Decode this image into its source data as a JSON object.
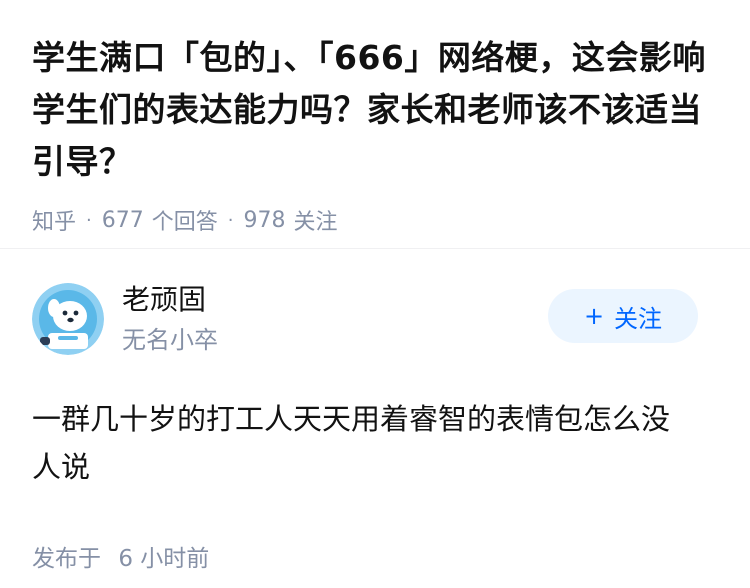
{
  "question": {
    "title": "学生满口「包的」、「666」网络梗，这会影响学生们的表达能力吗？家长和老师该不该适当引导？",
    "source": "知乎",
    "answer_count": "677",
    "answer_label": "个回答",
    "follower_count": "978",
    "follower_label": "关注"
  },
  "answer": {
    "author_name": "老顽固",
    "author_headline": "无名小卒",
    "follow_label": "关注",
    "follow_icon": "plus-icon",
    "content": "一群几十岁的打工人天天用着睿智的表情包怎么没人说",
    "published_label": "发布于",
    "published_time": "6 小时前"
  },
  "colors": {
    "primary": "#0066ff",
    "follow_bg": "#ebf5ff",
    "meta_text": "#8590a6",
    "title_text": "#121212"
  }
}
